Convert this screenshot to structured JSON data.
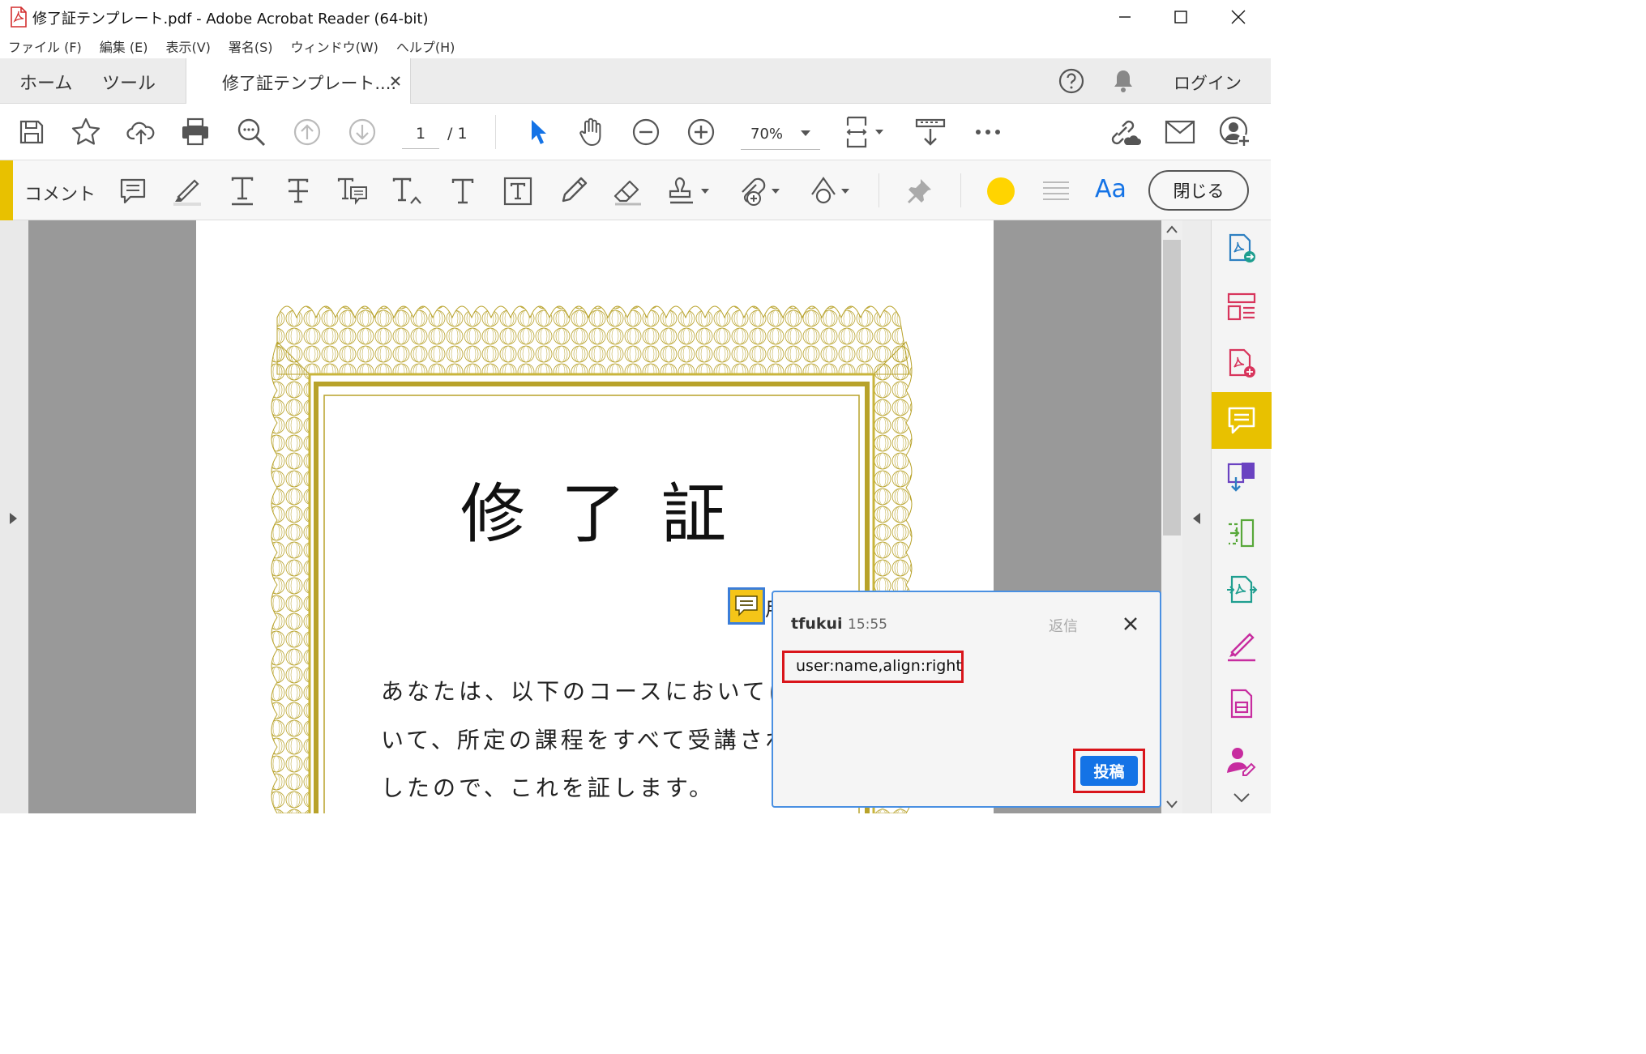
{
  "window": {
    "title": "修了証テンプレート.pdf - Adobe Acrobat Reader (64-bit)",
    "app_icon": "pdf-file-icon"
  },
  "menu": [
    "ファイル (F)",
    "編集 (E)",
    "表示(V)",
    "署名(S)",
    "ウィンドウ(W)",
    "ヘルプ(H)"
  ],
  "tabs": {
    "home": "ホーム",
    "tools": "ツール",
    "document": "修了証テンプレート....",
    "login": "ログイン"
  },
  "toolbar": {
    "page_current": "1",
    "page_total": "/ 1",
    "zoom": "70%",
    "icons": [
      "save-icon",
      "star-icon",
      "cloud-upload-icon",
      "print-icon",
      "search-zoom-icon",
      "page-up-icon",
      "page-down-icon",
      "select-arrow-icon",
      "hand-icon",
      "zoom-out-icon",
      "zoom-in-icon",
      "fit-page-icon",
      "scroll-mode-icon",
      "more-icon",
      "share-link-icon",
      "email-icon",
      "add-user-icon"
    ]
  },
  "comment_toolbar": {
    "label": "コメント",
    "close_label": "閉じる",
    "text_style_label": "Aa",
    "color": "#ffd400",
    "accent_color": "#e8c100"
  },
  "certificate": {
    "title": "修了証",
    "annotation_fragment": "用",
    "lines": [
      "あなたは、以下のコースにおいてにお",
      "いて、所定の課程をすべて受講されま",
      "したので、これを証します。"
    ],
    "border_color": "#b8a22a"
  },
  "popup": {
    "user": "tfukui",
    "time": "15:55",
    "reply": "返信",
    "text": "user:name,align:right",
    "post": "投稿",
    "highlight_color": "#d9151b",
    "button_color": "#1473e6"
  },
  "right_panel": {
    "icons": [
      "export-pdf-icon",
      "organize-pages-icon",
      "create-pdf-icon",
      "comment-icon",
      "combine-files-icon",
      "compress-icon",
      "edit-pdf-icon",
      "fill-sign-icon",
      "protect-icon",
      "request-signature-icon"
    ],
    "active_color": "#e8c100"
  }
}
